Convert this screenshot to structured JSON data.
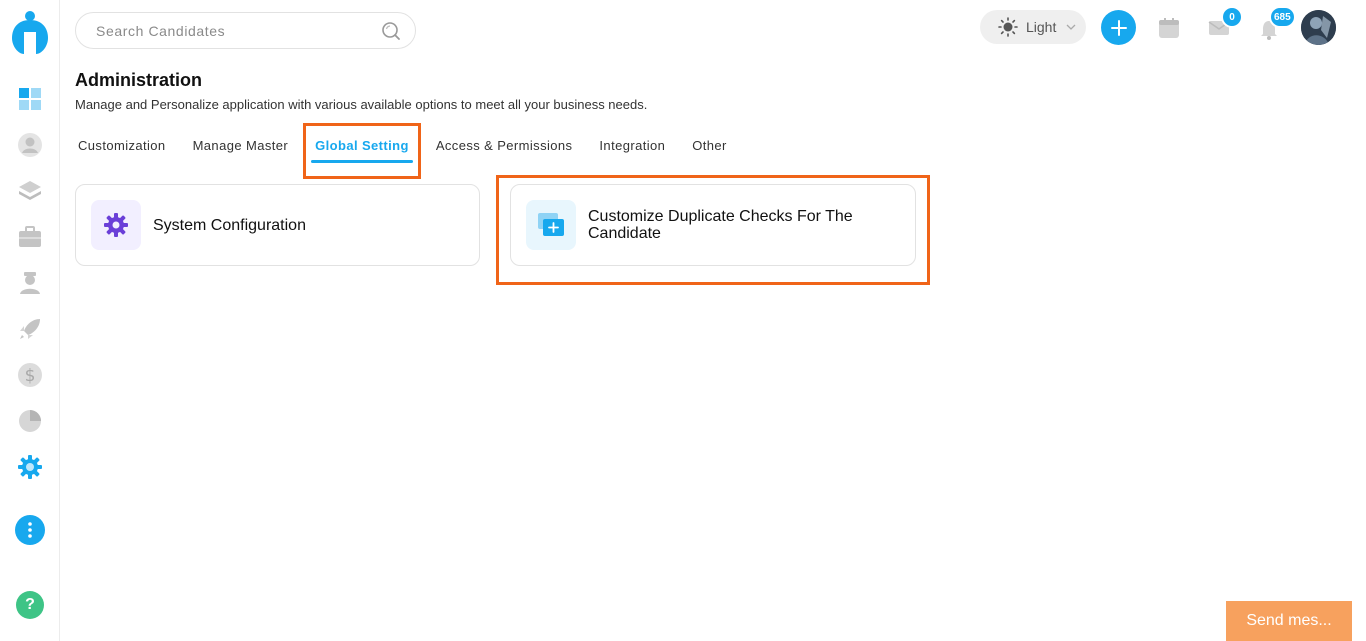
{
  "search": {
    "placeholder": "Search Candidates"
  },
  "header": {
    "theme_label": "Light",
    "mail_count": "0",
    "notification_count": "685"
  },
  "page": {
    "title": "Administration",
    "subtitle": "Manage and Personalize application with various available options to meet all your business needs."
  },
  "tabs": [
    {
      "label": "Customization"
    },
    {
      "label": "Manage Master"
    },
    {
      "label": "Global Setting",
      "active": true
    },
    {
      "label": "Access & Permissions"
    },
    {
      "label": "Integration"
    },
    {
      "label": "Other"
    }
  ],
  "cards": [
    {
      "title": "System Configuration",
      "icon": "gear-icon"
    },
    {
      "title_line1": "Customize Duplicate Checks For The",
      "title_line2": "Candidate",
      "icon": "duplicate-add-icon"
    }
  ],
  "chat": {
    "label": "Send mes..."
  },
  "colors": {
    "accent": "#17a8ee",
    "highlight": "#f06418",
    "chat": "#f7a15e"
  }
}
